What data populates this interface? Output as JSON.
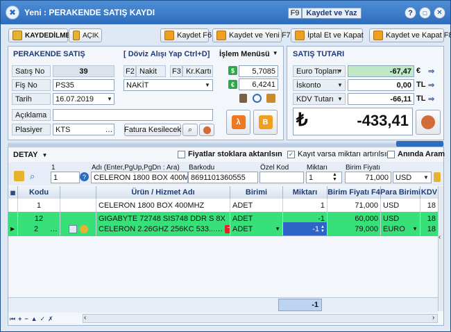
{
  "window": {
    "title": "Yeni : PERAKENDE SATIŞ KAYDI",
    "f9_key": "F9",
    "save_write": "Kaydet ve Yaz"
  },
  "toolbar": {
    "status_unsaved": "KAYDEDİLMEDİ",
    "status_open": "AÇIK",
    "save": "Kaydet F6",
    "save_new": "Kaydet ve Yeni F7",
    "cancel_close": "İptal Et ve Kapat",
    "save_close": "Kaydet ve Kapat F8"
  },
  "sale": {
    "title": "PERAKENDE SATIŞ",
    "fx_label": "[ Döviz Alışı Yap  Ctrl+D]",
    "process_menu": "İşlem Menüsü",
    "no_label": "Satış No",
    "no_value": "39",
    "receipt_label": "Fiş No",
    "receipt_value": "PS35",
    "date_label": "Tarih",
    "date_value": "16.07.2019",
    "desc_label": "Açıklama",
    "desc_value": "",
    "clerk_label": "Plasiyer",
    "clerk_value": "KTS",
    "invoice_button": "Fatura Kesilecek",
    "f2": "F2",
    "cash": "Nakit",
    "f3": "F3",
    "card": "Kr.Kartı",
    "payment_value": "NAKİT",
    "rate_usd": "5,7085",
    "rate_eur": "6,4241",
    "usd_symbol": "$",
    "eur_symbol": "€"
  },
  "totals": {
    "title": "SATIŞ TUTARI",
    "euro_label": "Euro Toplam",
    "euro_value": "-67,47",
    "euro_cur": "€",
    "discount_label": "İskonto",
    "discount_value": "0,00",
    "discount_cur": "TL",
    "vat_label": "KDV Tutarı",
    "vat_value": "-66,11",
    "vat_cur": "TL",
    "grand_total": "-433,41",
    "lira": "₺"
  },
  "detail": {
    "title": "DETAY",
    "opt_stock": "Fiyatlar stoklara aktarılsın",
    "opt_stock_checked": false,
    "opt_increase": "Kayıt varsa miktarı artırılsın",
    "opt_increase_checked": true,
    "opt_instant": "Anında Aram"
  },
  "entry": {
    "col1": "1",
    "name_label": "Adı  (Enter,PgUp,PgDn : Ara)",
    "barcode_label": "Barkodu",
    "special_label": "Özel Kod",
    "qty_label": "Miktarı",
    "price_label": "Birim Fiyatı",
    "col1_value": "1",
    "name_value": "CELERON 1800 BOX 400MHZ",
    "barcode_value": "8691101360555",
    "special_value": "",
    "qty_value": "1",
    "price_value": "71,000",
    "currency_value": "USD"
  },
  "grid": {
    "headers": [
      "Kodu",
      "Ürün / Hizmet Adı",
      "Birimi",
      "Miktarı",
      "Birim Fiyatı F4",
      "Para Birimi",
      "KDV"
    ],
    "rows": [
      {
        "code": "1",
        "name": "CELERON 1800 BOX 400MHZ",
        "unit": "ADET",
        "qty": "1",
        "price": "71,000",
        "cur": "USD",
        "vat": "18",
        "style": "white"
      },
      {
        "code": "12",
        "name": "GIGABYTE 72748 SIS748 DDR S 8X",
        "unit": "ADET",
        "qty": "-1",
        "price": "60,000",
        "cur": "USD",
        "vat": "18",
        "style": "green"
      },
      {
        "code": "2",
        "name": "CELERON 2.26GHZ 256KC 533...",
        "unit": "ADET",
        "qty": "-1",
        "price": "79,000",
        "cur": "EURO",
        "vat": "18",
        "style": "green"
      }
    ],
    "footer_qty": "-1"
  },
  "colors": {
    "green_row": "#38e07a",
    "title_blue": "#2d6cbd",
    "accent_orange": "#f0a020"
  }
}
